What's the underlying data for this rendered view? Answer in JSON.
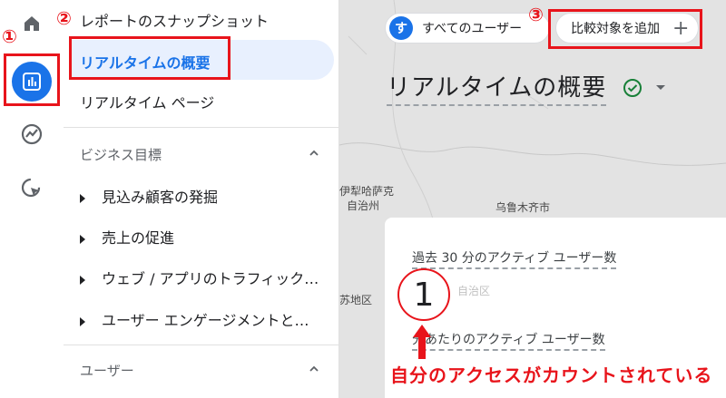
{
  "rail": {
    "items": [
      "home-icon",
      "reports-icon",
      "explore-icon",
      "advertising-icon"
    ]
  },
  "annotations": {
    "num1": "①",
    "num2": "②",
    "num3": "③",
    "callout": "自分のアクセスがカウントされている"
  },
  "nav": {
    "top_label": "レポートのスナップショット",
    "realtime_overview": "リアルタイムの概要",
    "realtime_pages": "リアルタイム ページ",
    "business_section": "ビジネス目標",
    "sub_items": [
      "見込み顧客の発掘",
      "売上の促進",
      "ウェブ / アプリのトラフィック…",
      "ユーザー エンゲージメントと…"
    ],
    "user_section": "ユーザー"
  },
  "header": {
    "avatar_letter": "す",
    "users_chip": "すべてのユーザー",
    "compare_chip": "比較対象を追加",
    "compare_plus": "+",
    "page_title": "リアルタイムの概要"
  },
  "map": {
    "labels": [
      "伊犁哈萨克",
      "自治州",
      "乌鲁木齐市",
      "苏地区",
      "自治区"
    ]
  },
  "card": {
    "metric1_label": "過去 30 分のアクティブ ユーザー数",
    "metric1_value": "1",
    "metric2_label": "分あたりのアクティブ ユーザー数"
  },
  "colors": {
    "accent": "#1a73e8",
    "annotation": "#e8141b",
    "check": "#188038"
  }
}
